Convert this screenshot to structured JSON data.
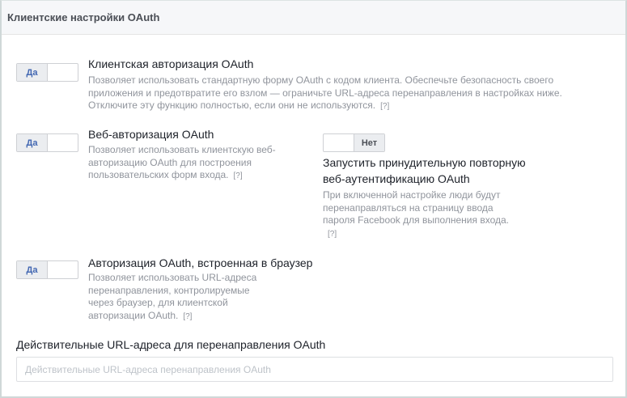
{
  "header": {
    "title": "Клиентские настройки OAuth"
  },
  "settings": [
    {
      "toggle": "Да",
      "state": "on",
      "title": "Клиентская авторизация OAuth",
      "description": "Позволяет использовать стандартную форму OAuth с кодом клиента. Обеспечьте безопасность своего приложения и предотвратите его взлом — ограничьте URL-адреса перенаправления в настройках ниже. Отключите эту функцию полностью, если они не используются.",
      "help": "[?]"
    },
    {
      "toggle": "Да",
      "state": "on",
      "title": "Веб-авторизация OAuth",
      "description": "Позволяет использовать клиентскую веб-авторизацию OAuth для построения пользовательских форм входа.",
      "help": "[?]"
    },
    {
      "toggle": "Нет",
      "state": "off",
      "title": "Запустить принудительную повторную веб-аутентификацию OAuth",
      "description": "При включенной настройке люди будут перенаправляться на страницу ввода пароля Facebook для выполнения входа.",
      "help": "[?]"
    },
    {
      "toggle": "Да",
      "state": "on",
      "title": "Авторизация OAuth, встроенная в браузер",
      "description": "Позволяет использовать URL-адреса перенаправления, контролируемые через браузер, для клиентской авторизации OAuth.",
      "help": "[?]"
    }
  ],
  "redirect": {
    "label": "Действительные URL-адреса для перенаправления OAuth",
    "placeholder": "Действительные URL-адреса перенаправления OAuth",
    "value": ""
  }
}
